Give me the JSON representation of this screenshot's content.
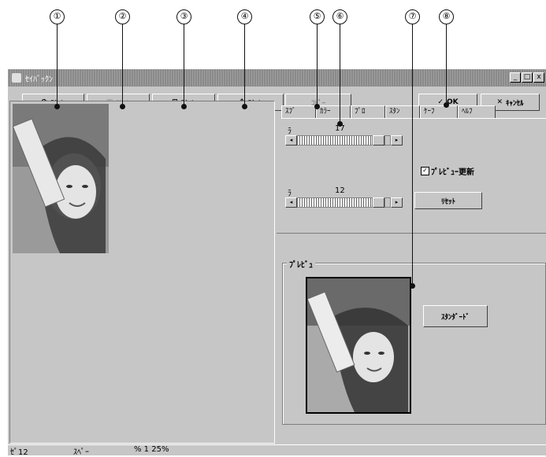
{
  "callouts": [
    "①",
    "②",
    "③",
    "④",
    "⑤",
    "⑥",
    "⑦",
    "⑧"
  ],
  "window": {
    "title": "ｾｲﾊﾞｯｸﾝ",
    "min": "_",
    "max": "□",
    "close": "x"
  },
  "toolbar": {
    "btn1": "ｽｷｬﾝ",
    "btn2": "ｽｷｬﾝ",
    "btn3": "ｽｷｬﾝ",
    "btn4": "ｽｷｬﾝ",
    "btn5": "ｺﾋﾟｰ",
    "ok": "OK",
    "cancel": "ｷｬﾝｾﾙ"
  },
  "tabs": [
    "ｽﾌﾞ",
    "ｶﾗｰ",
    "ﾌﾟﾛ",
    "ｽﾀﾝ",
    "ｹｰﾌ",
    "ﾍﾙﾌ"
  ],
  "adjust": {
    "slider1_label": "ﾗ",
    "slider1_value": "17",
    "slider2_label": "ﾗ",
    "slider2_value": "12",
    "checkbox_label": "ﾌﾟﾚﾋﾞｭｰ更新",
    "reset_button": "ﾘｾｯﾄ"
  },
  "preview_group": {
    "title": "ﾌﾟﾚﾋﾞｭ",
    "button": "ｽﾀﾝﾀﾞｰﾄﾞ"
  },
  "status": {
    "field1": "ｾﾟ12",
    "field2": "ｽﾍﾟｰ",
    "field3": "% 1 25%"
  },
  "colors": {
    "window_bg": "#c6c6c6",
    "titlebar": "#8a8a8a"
  },
  "icons": [
    "scan-icon",
    "preview-icon",
    "scanner-icon",
    "copy-icon",
    "ok-check-icon",
    "cancel-x-icon"
  ]
}
